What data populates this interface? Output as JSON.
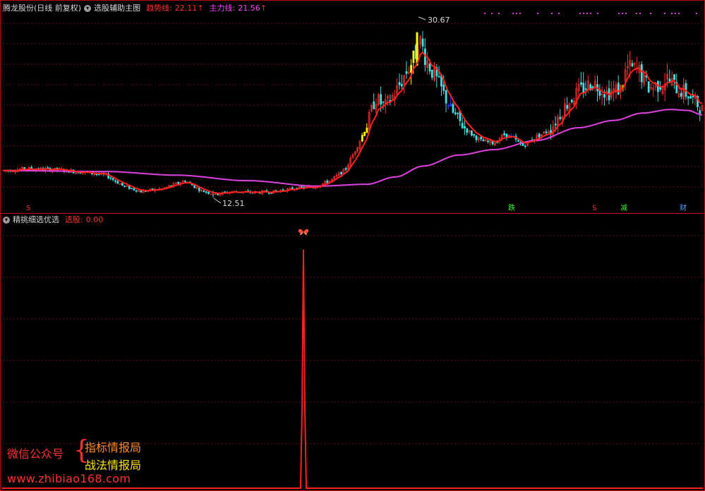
{
  "top_header": {
    "stock_name": "腾龙股份(日线 前复权)",
    "indicator_name": "选股辅助主图",
    "trend_label": "趋势线:",
    "trend_value": "22.11",
    "main_label": "主力线:",
    "main_value": "21.56",
    "arrow": "↑"
  },
  "bottom_header": {
    "indicator_name": "精挑细选优选",
    "select_label": "选股:",
    "select_value": "0.00"
  },
  "watermark": {
    "wechat": "微信公众号",
    "brace": "{",
    "name1": "指标情报局",
    "name2": "战法情报局",
    "site": "www.zhibiao168.com"
  },
  "signals": [
    {
      "text": "S",
      "color": "#ff3030"
    },
    {
      "text": "跌",
      "color": "#30ff30"
    },
    {
      "text": "S",
      "color": "#ff3030"
    },
    {
      "text": "减",
      "color": "#30ff30"
    },
    {
      "text": "财",
      "color": "#60a0ff"
    }
  ],
  "icons": {
    "collapse": "circle-down-icon",
    "marker": "butterfly-icon"
  },
  "colors": {
    "up": "#ff3030",
    "down": "#40e0e0",
    "trend": "#ff2020",
    "main": "#e040e0",
    "grid": "#6a1010",
    "highlight_yellow": "#ffff00",
    "highlight_blue": "#2040ff"
  },
  "chart_data": {
    "type": "candlestick",
    "y_axis": "price",
    "ylim": [
      11.0,
      32.5
    ],
    "annotations": [
      {
        "text": "30.67",
        "value": 30.67,
        "kind": "high"
      },
      {
        "text": "12.51",
        "value": 12.51,
        "kind": "low"
      }
    ],
    "series": [
      {
        "name": "趋势线",
        "last": 22.11
      },
      {
        "name": "主力线",
        "last": 21.56
      }
    ],
    "indicator_panel": {
      "name": "精挑细选优选",
      "series": [
        {
          "name": "选股",
          "last": 0.0
        }
      ],
      "spike_count": 1
    }
  }
}
